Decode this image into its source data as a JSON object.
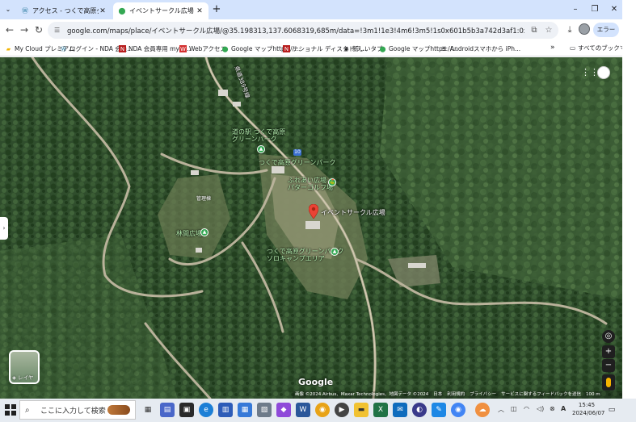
{
  "browser": {
    "tabs": [
      {
        "title": "アクセス - つくで高原グリーンパーク",
        "active": false
      },
      {
        "title": "イベントサークル広場 - Google マップ",
        "active": true
      }
    ],
    "new_tab": "+",
    "window_controls": {
      "minimize": "–",
      "restore": "❐",
      "close": "✕"
    }
  },
  "toolbar": {
    "url": "google.com/maps/place/イベントサークル広場/@35.198313,137.6068319,685m/data=!3m1!1e3!4m6!3m5!1s0x601b5b3a742d3af1:0xfc296e68399dd934!8m2!3d35.1984514!4d137.6068969!...",
    "error_button": "エラー"
  },
  "bookmarks": [
    {
      "label": "My Cloud プレミアム",
      "icon": "folder-icon"
    },
    {
      "label": "ログイン - NDA 会員...",
      "icon": "wordpress-icon"
    },
    {
      "label": "NDA 会員専用 my p...",
      "icon": "nda-icon"
    },
    {
      "label": "Webアクセス",
      "icon": "web-icon"
    },
    {
      "label": "Google マップhttps://...",
      "icon": "maps-icon"
    },
    {
      "label": "ナショナル ディスクドラ...",
      "icon": "nda-icon"
    },
    {
      "label": "新しいタブ",
      "icon": "globe-icon"
    },
    {
      "label": "Google マップhttps://...",
      "icon": "maps-icon"
    },
    {
      "label": "Androidスマホから iPh...",
      "icon": "doc-icon"
    }
  ],
  "bookmarks_all": "すべてのブックマーク",
  "map": {
    "pin_label": "イベントサークル広場",
    "labels": {
      "road_name": "県道389号線",
      "michi_no_eki": "道の駅 つくで高原\nグリーンパーク",
      "tsukude_green_park": "つくで高原グリーンパーク",
      "fureai": "ふれあい広場\nパターゴルフ場",
      "rinkan": "林間広場",
      "solo_camp": "つくで高原グリーンパーク\nソロキャンプエリア"
    },
    "route_shield": "10",
    "building_label": "管理棟",
    "layer_button": "レイヤ",
    "logo": "Google",
    "attribution": [
      "画像 ©2024 Airbus、Maxar Technologies、地図データ ©2024",
      "日本",
      "利用規約",
      "プライバシー",
      "サービスに関するフィードバックを送信",
      "100 m"
    ],
    "zoom_in": "+",
    "zoom_out": "−"
  },
  "taskbar": {
    "search_placeholder": "ここに入力して検索",
    "time": "15:45",
    "date": "2024/06/07",
    "ime": "A"
  }
}
